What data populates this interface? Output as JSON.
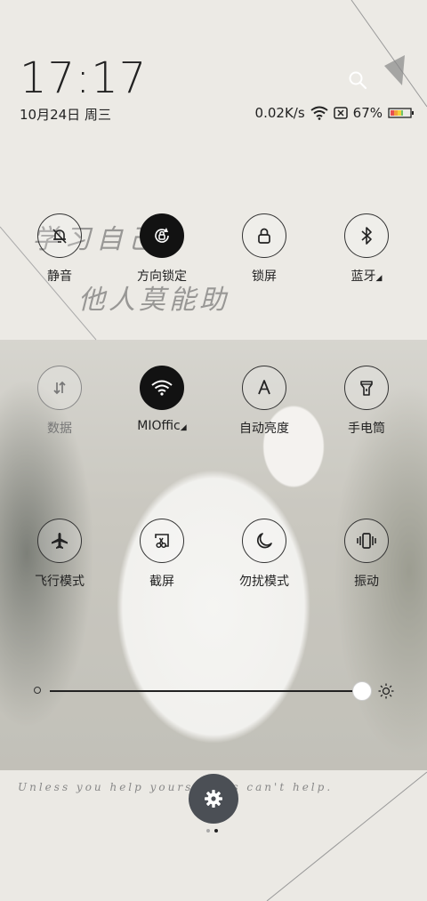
{
  "status": {
    "time": "17:17",
    "date": "10月24日 周三",
    "speed": "0.02K/s",
    "battery": "67%"
  },
  "background": {
    "handwriting_1": "学习自己",
    "handwriting_2": "他人莫能助",
    "quote": "Unless you help yours      thers can't help."
  },
  "toggles": [
    {
      "label": "静音",
      "icon": "bell-off-icon",
      "state": "off"
    },
    {
      "label": "方向锁定",
      "icon": "rotation-lock-icon",
      "state": "on"
    },
    {
      "label": "锁屏",
      "icon": "lock-icon",
      "state": "off"
    },
    {
      "label": "蓝牙",
      "icon": "bluetooth-icon",
      "state": "off"
    },
    {
      "label": "数据",
      "icon": "mobile-data-icon",
      "state": "disabled"
    },
    {
      "label": "MIOffic",
      "icon": "wifi-icon",
      "state": "on"
    },
    {
      "label": "自动亮度",
      "icon": "auto-brightness-icon",
      "state": "off"
    },
    {
      "label": "手电筒",
      "icon": "flashlight-icon",
      "state": "off"
    },
    {
      "label": "飞行模式",
      "icon": "airplane-icon",
      "state": "off"
    },
    {
      "label": "截屏",
      "icon": "screenshot-icon",
      "state": "off"
    },
    {
      "label": "勿扰模式",
      "icon": "moon-icon",
      "state": "off"
    },
    {
      "label": "振动",
      "icon": "vibrate-icon",
      "state": "off"
    }
  ],
  "brightness": {
    "level": 1.0
  },
  "pager": {
    "pages": 2,
    "current": 2
  },
  "colors": {
    "active_circle": "#121212",
    "settings_button": "#4b4f55"
  }
}
